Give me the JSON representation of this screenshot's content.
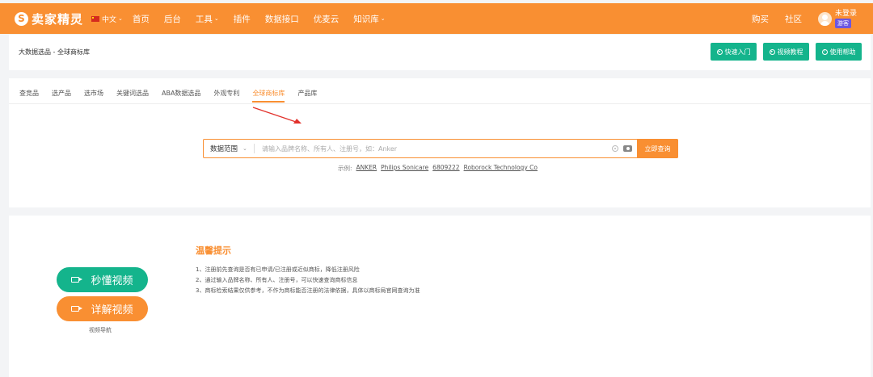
{
  "nav": {
    "logo_mark": "S",
    "logo_text": "卖家精灵",
    "language": "中文",
    "items": [
      {
        "label": "首页",
        "dropdown": false
      },
      {
        "label": "后台",
        "dropdown": false
      },
      {
        "label": "工具",
        "dropdown": true
      },
      {
        "label": "插件",
        "dropdown": false
      },
      {
        "label": "数据接口",
        "dropdown": false
      },
      {
        "label": "优麦云",
        "dropdown": false
      },
      {
        "label": "知识库",
        "dropdown": true
      }
    ],
    "right_items": [
      "购买",
      "社区"
    ],
    "user_name": "未登录",
    "user_badge": "游客"
  },
  "header": {
    "breadcrumb": "大数据选品 - 全球商标库",
    "buttons": [
      "快速入门",
      "视频教程",
      "使用帮助"
    ]
  },
  "tabs": {
    "items": [
      "查竞品",
      "选产品",
      "选市场",
      "关键词选品",
      "ABA数据选品",
      "外观专利",
      "全球商标库",
      "产品库"
    ],
    "active_index": 6
  },
  "search": {
    "scope_label": "数据范围",
    "placeholder": "请输入品牌名称、所有人、注册号，如：Anker",
    "button_label": "立即查询",
    "examples_label": "示例:",
    "examples": [
      "ANKER",
      "Philips Sonicare",
      "6809222",
      "Roborock Technology Co"
    ]
  },
  "video": {
    "quick_label": "秒懂视频",
    "detail_label": "详解视频",
    "nav_label": "视频导航"
  },
  "tips": {
    "title": "温馨提示",
    "items": [
      "1、注册前先查询是否有已申请/已注册或近似商标，降低注册风险",
      "2、通过输入品牌名称、所有人、注册号，可以快速查询商标信息",
      "3、商标检索结果仅供参考，不作为商标能否注册的法律依据，具体以商标局官网查询为准"
    ]
  },
  "colors": {
    "brand_orange": "#f98f32",
    "teal": "#14b48c",
    "guest_badge": "#6c56e0"
  }
}
